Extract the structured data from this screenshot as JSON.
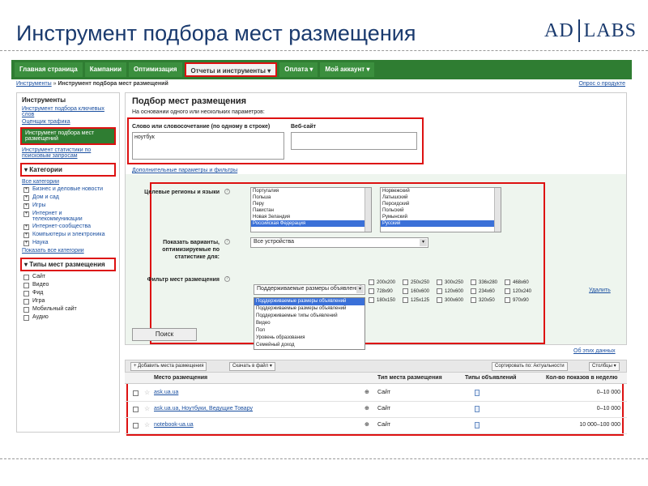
{
  "slide": {
    "title": "Инструмент подбора мест размещения",
    "logo_left": "AD",
    "logo_right": "LABS"
  },
  "navbar": {
    "items": [
      {
        "label": "Главная страница"
      },
      {
        "label": "Кампании"
      },
      {
        "label": "Оптимизация"
      },
      {
        "label": "Отчеты и инструменты ▾"
      },
      {
        "label": "Оплата ▾"
      },
      {
        "label": "Мой аккаунт ▾"
      }
    ]
  },
  "breadcrumb": {
    "link": "Инструменты",
    "sep": " » ",
    "current": "Инструмент подбора мест размещений"
  },
  "help_link": "Опрос о продукте",
  "sidebar": {
    "tools_heading": "Инструменты",
    "tool_links": [
      "Инструмент подбора ключевых слов",
      "Оценщик трафика"
    ],
    "selected_tool": "Инструмент подбора мест размещений",
    "tool_link_after": "Инструмент статистики по поисковым запросам",
    "categories_heading": "▾ Категории",
    "all_categories": "Все категории",
    "categories": [
      "Бизнес и деловые новости",
      "Дом и сад",
      "Игры",
      "Интернет и телекоммуникации",
      "Интернет-сообщества",
      "Компьютеры и электроника",
      "Наука"
    ],
    "show_all": "Показать все категории",
    "placement_types_heading": "▾ Типы мест размещения",
    "placement_types": [
      "Сайт",
      "Видео",
      "Фид",
      "Игра",
      "Мобильный сайт",
      "Аудио"
    ]
  },
  "main": {
    "title": "Подбор мест размещения",
    "subtitle": "На основании одного или нескольких параметров:",
    "keywords_label": "Слово или словосочетание (по одному в строке)",
    "keywords_value": "ноутбук",
    "website_label": "Веб-сайт",
    "advanced_link": "Дополнительные параметры и фильтры",
    "geo_label": "Целевые регионы и языки",
    "countries": [
      "Португалия",
      "Польша",
      "Перу",
      "Пакистан",
      "Новая Зеландия",
      "Российская Федерация"
    ],
    "languages": [
      "Норвежский",
      "Латышский",
      "Персидский",
      "Польский",
      "Румынский",
      "Русский"
    ],
    "stats_label": "Показать варианты, оптимизируемые по статистике для:",
    "stats_value": "Все устройства",
    "filter_label": "Фильтр мест размещения",
    "filter_value": "Поддерживаемые размеры объявлений",
    "filter_options": [
      "Поддерживаемые размеры объявлений",
      "Поддерживаемые размеры объявлений",
      "Поддерживаемые типы объявлений",
      "Видео",
      "Пол",
      "Уровень образования",
      "Семейный доход"
    ],
    "sizes": [
      "200x200",
      "250x250",
      "300x250",
      "336x280",
      "468x60",
      "728x90",
      "160x600",
      "120x600",
      "234x60",
      "120x240",
      "180x150",
      "125x125",
      "300x600",
      "320x50",
      "970x90"
    ],
    "delete_link": "Удалить",
    "search_button": "Поиск",
    "summary_link": "Об этих данных",
    "toolbar": {
      "add_button": "+ Добавить места размещения",
      "download_button": "Скачать в файл ▾",
      "sort_label": "Сортировать по: Актуальности",
      "columns_button": "Столбцы ▾"
    },
    "table": {
      "headers": [
        "Место размещения",
        "Тип места размещения",
        "Типы объявлений",
        "Кол-во показов в неделю"
      ],
      "rows": [
        {
          "placement": "ask.ua.ua",
          "type": "Сайт",
          "impressions": "0–10 000"
        },
        {
          "placement": "ask.ua.ua, Ноутбуки, Ведущие Товару",
          "type": "Сайт",
          "impressions": "0–10 000"
        },
        {
          "placement": "notebook-ua.ua",
          "type": "Сайт",
          "impressions": "10 000–100 000"
        }
      ]
    }
  }
}
